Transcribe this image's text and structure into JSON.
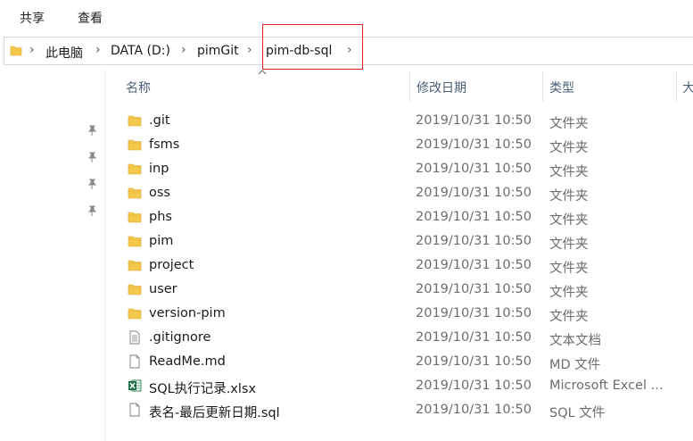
{
  "ribbon": {
    "tabs": [
      "共享",
      "查看"
    ]
  },
  "address": {
    "crumbs": [
      "此电脑",
      "DATA (D:)",
      "pimGit",
      "pim-db-sql"
    ]
  },
  "columns": {
    "name": "名称",
    "date": "修改日期",
    "type": "类型",
    "size": "大"
  },
  "colors": {
    "highlight": "#e0231f",
    "folder": "#f3c84b",
    "excel": "#1d7044"
  },
  "files": [
    {
      "name": ".git",
      "date": "2019/10/31 10:50",
      "type": "文件夹",
      "icon": "folder-icon"
    },
    {
      "name": "fsms",
      "date": "2019/10/31 10:50",
      "type": "文件夹",
      "icon": "folder-icon"
    },
    {
      "name": "inp",
      "date": "2019/10/31 10:50",
      "type": "文件夹",
      "icon": "folder-icon"
    },
    {
      "name": "oss",
      "date": "2019/10/31 10:50",
      "type": "文件夹",
      "icon": "folder-icon"
    },
    {
      "name": "phs",
      "date": "2019/10/31 10:50",
      "type": "文件夹",
      "icon": "folder-icon"
    },
    {
      "name": "pim",
      "date": "2019/10/31 10:50",
      "type": "文件夹",
      "icon": "folder-icon"
    },
    {
      "name": "project",
      "date": "2019/10/31 10:50",
      "type": "文件夹",
      "icon": "folder-icon"
    },
    {
      "name": "user",
      "date": "2019/10/31 10:50",
      "type": "文件夹",
      "icon": "folder-icon"
    },
    {
      "name": "version-pim",
      "date": "2019/10/31 10:50",
      "type": "文件夹",
      "icon": "folder-icon"
    },
    {
      "name": ".gitignore",
      "date": "2019/10/31 10:50",
      "type": "文本文档",
      "icon": "text-file-icon"
    },
    {
      "name": "ReadMe.md",
      "date": "2019/10/31 10:50",
      "type": "MD 文件",
      "icon": "blank-file-icon"
    },
    {
      "name": "SQL执行记录.xlsx",
      "date": "2019/10/31 10:50",
      "type": "Microsoft Excel ...",
      "icon": "excel-file-icon"
    },
    {
      "name": "表名-最后更新日期.sql",
      "date": "2019/10/31 10:50",
      "type": "SQL 文件",
      "icon": "blank-file-icon"
    }
  ]
}
